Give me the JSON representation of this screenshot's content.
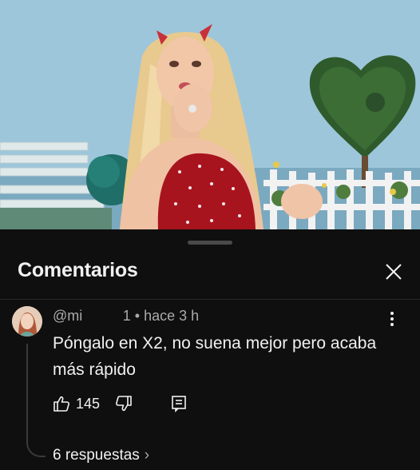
{
  "video": {
    "icon": "video-frame-image"
  },
  "panel": {
    "title": "Comentarios",
    "close_icon": "close-icon"
  },
  "comment": {
    "author": "@mi              1",
    "time": "hace 3 h",
    "text": "Póngalo en X2, no suena mejor pero acaba más rápido",
    "likes": "145",
    "replies_label": "6 respuestas",
    "replies_chevron": "›"
  },
  "colors": {
    "background": "#0f0f0f",
    "text": "#f1f1f1",
    "secondary": "#aaaaaa"
  }
}
